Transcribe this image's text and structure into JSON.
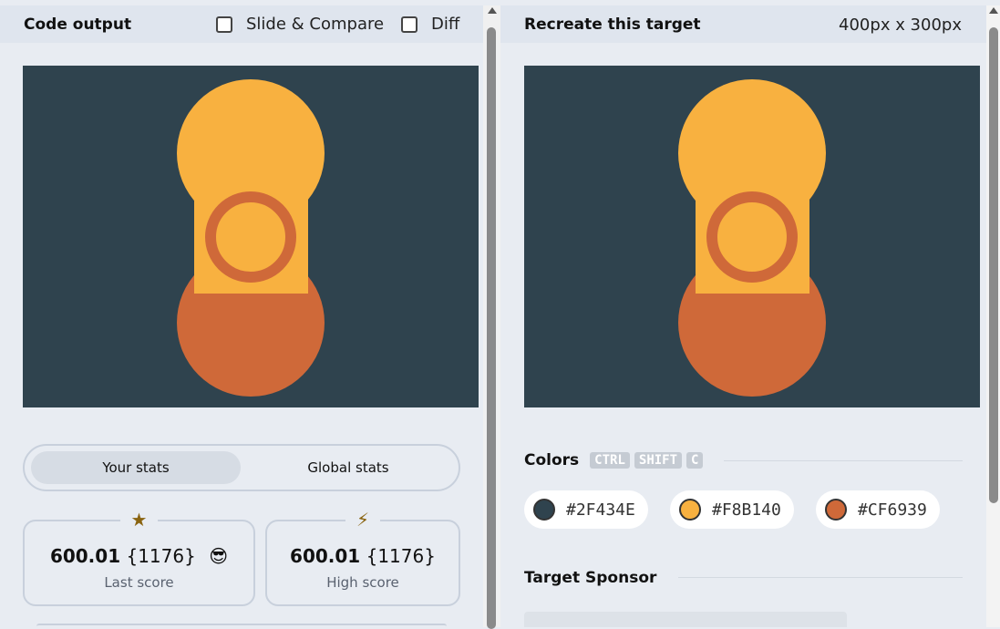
{
  "left": {
    "title": "Code output",
    "options": [
      {
        "label": "Slide & Compare",
        "checked": false
      },
      {
        "label": "Diff",
        "checked": false
      }
    ],
    "stats_tabs": {
      "active": "Your stats",
      "inactive": "Global stats"
    },
    "cards": [
      {
        "icon": "star-icon",
        "glyph": "★",
        "score": "600.01",
        "count": "{1176}",
        "emoji": "😎",
        "label": "Last score"
      },
      {
        "icon": "lightning-icon",
        "glyph": "⚡",
        "score": "600.01",
        "count": "{1176}",
        "label": "High score"
      }
    ]
  },
  "right": {
    "title": "Recreate this target",
    "dimensions": "400px x 300px",
    "colors_heading": "Colors",
    "shortcut_keys": [
      "CTRL",
      "SHIFT",
      "C"
    ],
    "colors": [
      {
        "hex": "#2F434E",
        "swatch": "#2f434e"
      },
      {
        "hex": "#F8B140",
        "swatch": "#f8b140"
      },
      {
        "hex": "#CF6939",
        "swatch": "#cf6939"
      }
    ],
    "sponsor_heading": "Target Sponsor"
  },
  "palette": {
    "background": "#2f434e",
    "yellow": "#f8b140",
    "orange": "#cf6939"
  }
}
